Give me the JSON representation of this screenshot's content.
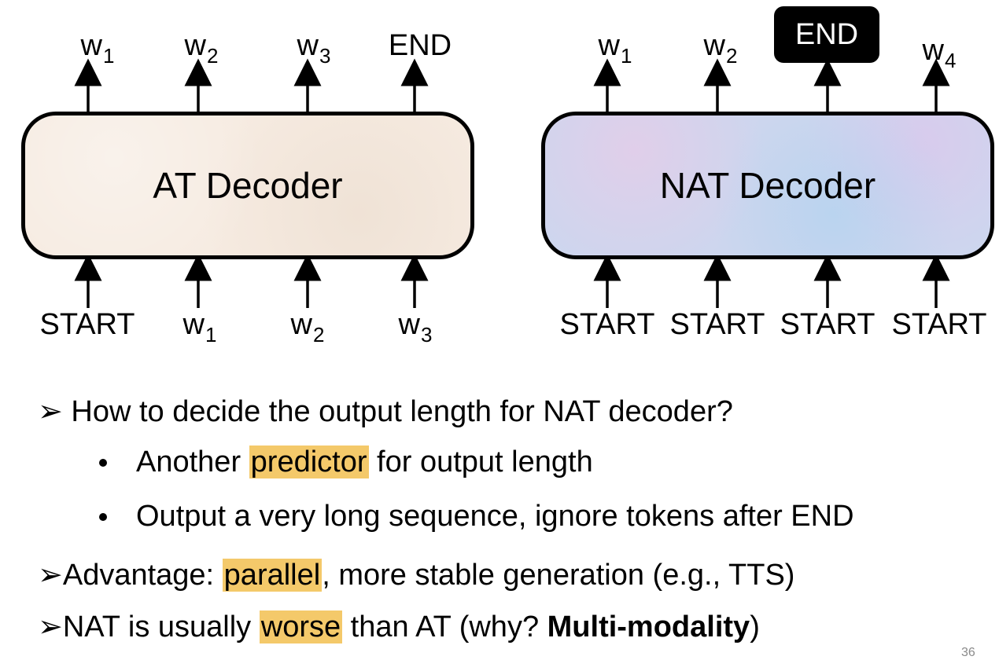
{
  "at": {
    "box_label": "AT Decoder",
    "outputs": [
      {
        "t": "w",
        "s": "1"
      },
      {
        "t": "w",
        "s": "2"
      },
      {
        "t": "w",
        "s": "3"
      },
      {
        "t": "END",
        "s": ""
      }
    ],
    "inputs": [
      {
        "t": "START",
        "s": ""
      },
      {
        "t": "w",
        "s": "1"
      },
      {
        "t": "w",
        "s": "2"
      },
      {
        "t": "w",
        "s": "3"
      }
    ]
  },
  "nat": {
    "box_label": "NAT Decoder",
    "outputs": [
      {
        "t": "w",
        "s": "1"
      },
      {
        "t": "w",
        "s": "2"
      },
      {
        "t": "END",
        "s": ""
      },
      {
        "t": "w",
        "s": "4"
      }
    ],
    "inputs": [
      {
        "t": "START",
        "s": ""
      },
      {
        "t": "START",
        "s": ""
      },
      {
        "t": "START",
        "s": ""
      },
      {
        "t": "START",
        "s": ""
      }
    ]
  },
  "bullets": {
    "b1": "How to decide the output length for NAT decoder?",
    "b1a_pre": "Another ",
    "b1a_hl": "predictor",
    "b1a_post": " for output length",
    "b1b": "Output a very long sequence, ignore tokens after END",
    "b2_pre": "Advantage: ",
    "b2_hl": "parallel",
    "b2_post": ", more stable generation (e.g., TTS)",
    "b3_pre": "NAT is usually ",
    "b3_hl": "worse",
    "b3_mid": " than AT   (why? ",
    "b3_bold": "Multi-modality",
    "b3_post": ")"
  },
  "page_number": "36",
  "colors": {
    "highlight": "#f4c96a",
    "at_fill": "#f6ebe1",
    "nat_fill": "#cdd6ee"
  }
}
